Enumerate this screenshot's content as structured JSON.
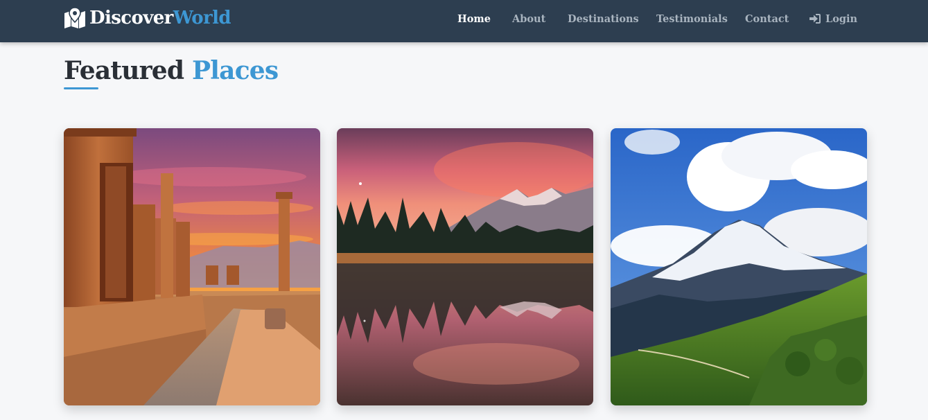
{
  "brand": {
    "part1": "Discover",
    "part2": "World",
    "icon": "map-marker-icon"
  },
  "nav": {
    "home": "Home",
    "about": "About",
    "destinations": "Destinations",
    "testimonials": "Testimonials",
    "contact": "Contact",
    "login": "Login",
    "login_icon": "sign-in-icon",
    "active": "Home"
  },
  "section": {
    "title_part1": "Featured",
    "title_part2": "Places"
  },
  "colors": {
    "navbar_bg": "#2d3e50",
    "accent": "#3d97d3",
    "page_bg": "#f6f7f9"
  }
}
